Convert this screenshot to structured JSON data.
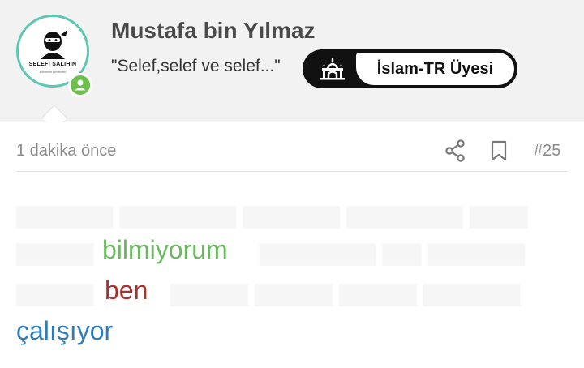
{
  "post": {
    "username": "Mustafa bin Yılmaz",
    "status": "\"Selef,selef ve selef...\"",
    "badge_label": "İslam-TR Üyesi",
    "avatar_logo_title": "SELEFI SALIHIN",
    "avatar_logo_sub": "Bilmenin Örnekleri",
    "time": "1 dakika önce",
    "post_number": "#25"
  },
  "body": {
    "word_bilmiyorum": "bilmiyorum",
    "word_ben": "ben",
    "word_calisiyor": "çalışıyor"
  },
  "colors": {
    "avatar_ring": "#5ec7b4",
    "online": "#6dbf4b",
    "word_green": "#6cb860",
    "word_red": "#a83232",
    "word_blue": "#2f7cb8",
    "meta_gray": "#8a8a8a"
  },
  "icons": {
    "badge": "mosque-icon",
    "share": "share-icon",
    "bookmark": "bookmark-icon",
    "online": "user-icon"
  }
}
